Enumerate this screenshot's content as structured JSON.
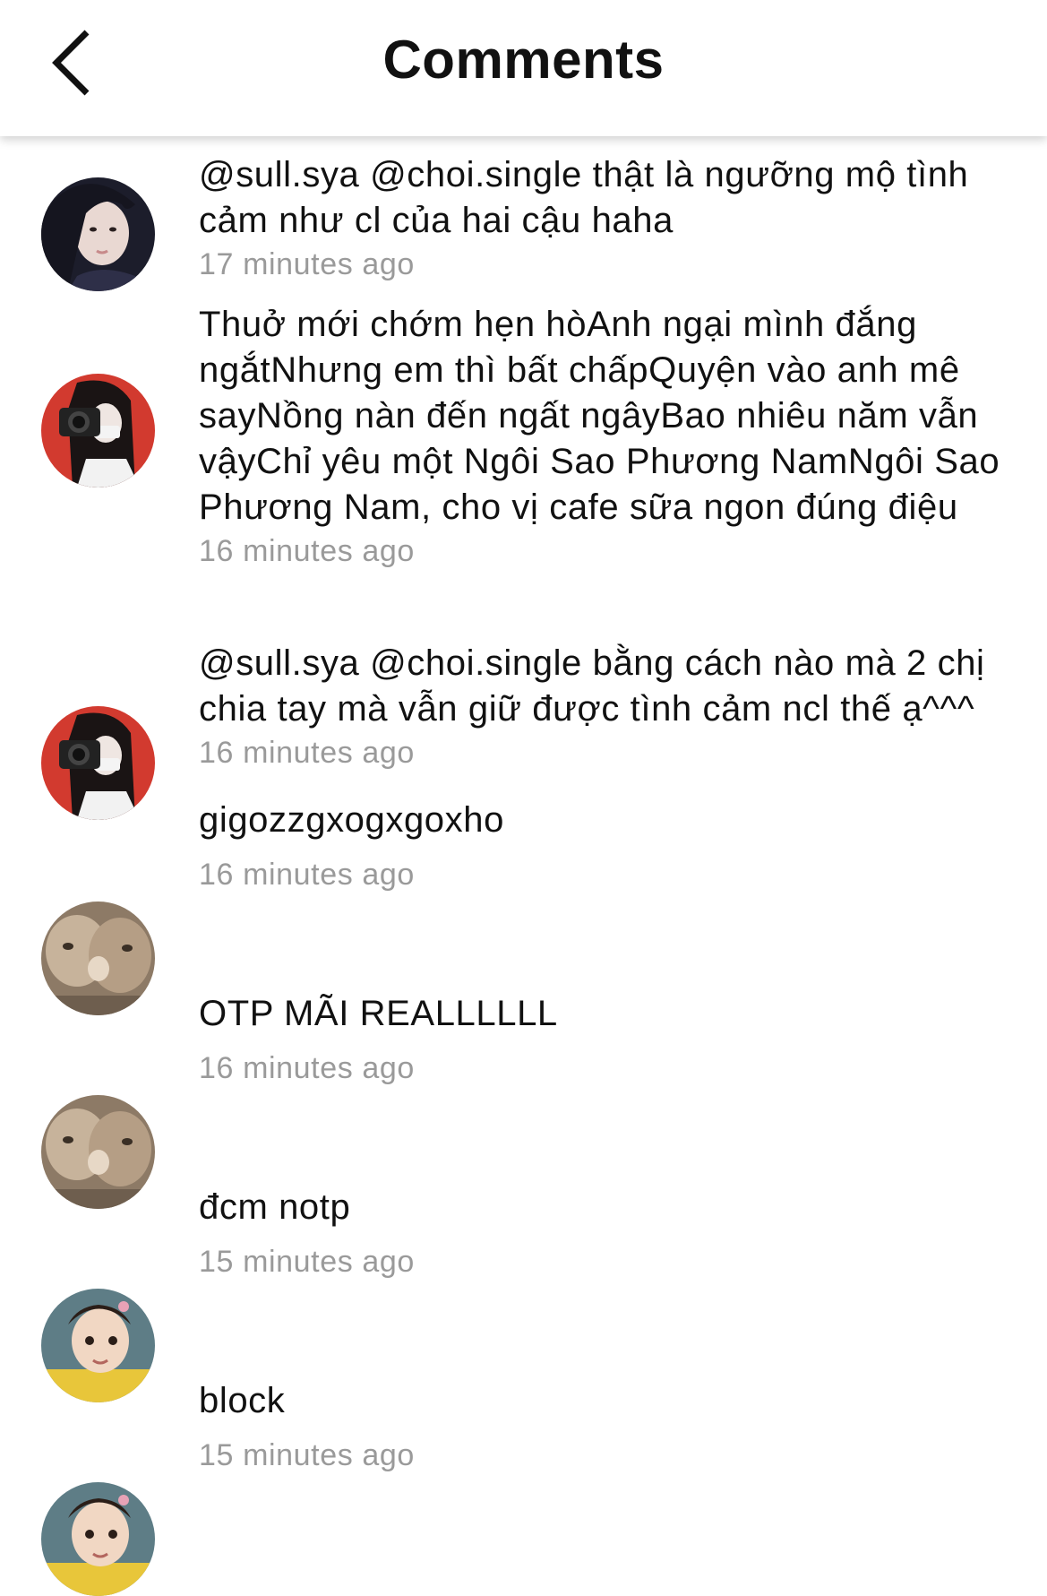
{
  "header": {
    "title": "Comments",
    "back_icon": "chevron-left-icon"
  },
  "comments": [
    {
      "avatar": "girl-dark-hair",
      "text": "@sull.sya @choi.single thật là ngưỡng mộ tình cảm như cl của hai cậu haha",
      "time": "17 minutes ago"
    },
    {
      "avatar": "girl-camera-red",
      "text": "Thuở mới chớm hẹn hòAnh ngại mình đắng ngắtNhưng em thì bất chấpQuyện vào anh mê sayNồng nàn đến ngất ngâyBao nhiêu năm vẫn vậyChỉ yêu một Ngôi Sao Phương NamNgôi Sao Phương Nam, cho vị cafe sữa ngon đúng điệu",
      "time": "16 minutes ago"
    },
    {
      "avatar": "girl-camera-red",
      "text": "@sull.sya @choi.single bằng cách nào mà 2 chị chia tay mà vẫn giữ được tình cảm ncl thế ạ^^^",
      "time": "16 minutes ago"
    },
    {
      "avatar": "cats-kissing",
      "text": "gigozzgxogxgoxho",
      "time": "16 minutes ago"
    },
    {
      "avatar": "cats-kissing",
      "text": "OTP MÃI REALLLLLL",
      "time": "16 minutes ago"
    },
    {
      "avatar": "little-girl",
      "text": "đcm notp",
      "time": "15 minutes ago"
    },
    {
      "avatar": "little-girl",
      "text": "block",
      "time": "15 minutes ago"
    }
  ]
}
